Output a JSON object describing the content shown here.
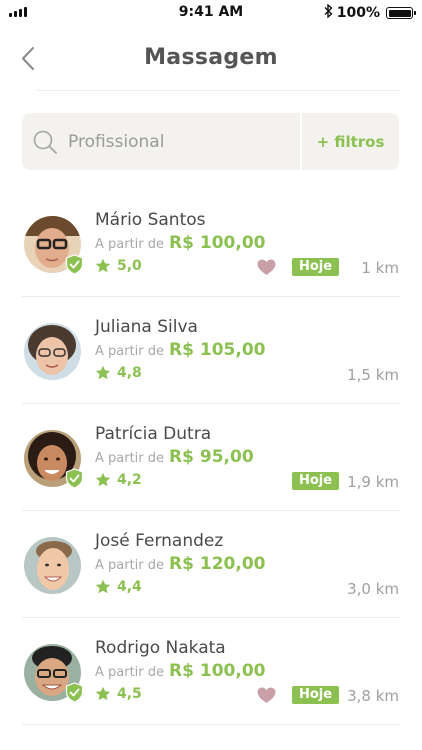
{
  "status": {
    "time": "9:41 AM",
    "battery": "100%"
  },
  "nav": {
    "title": "Massagem"
  },
  "search": {
    "placeholder": "Profissional",
    "filters_label": "+ filtros"
  },
  "list": {
    "items": [
      {
        "name": "Mário Santos",
        "price_prefix": "A partir de",
        "price": "R$ 100,00",
        "rating": "5,0",
        "badge": "Hoje",
        "distance": "1 km",
        "favorite": true,
        "verified": true
      },
      {
        "name": "Juliana Silva",
        "price_prefix": "A partir de",
        "price": "R$ 105,00",
        "rating": "4,8",
        "badge": "",
        "distance": "1,5 km",
        "favorite": false,
        "verified": false
      },
      {
        "name": "Patrícia Dutra",
        "price_prefix": "A partir de",
        "price": "R$ 95,00",
        "rating": "4,2",
        "badge": "Hoje",
        "distance": "1,9 km",
        "favorite": false,
        "verified": true
      },
      {
        "name": "José Fernandez",
        "price_prefix": "A partir de",
        "price": "R$ 120,00",
        "rating": "4,4",
        "badge": "",
        "distance": "3,0 km",
        "favorite": false,
        "verified": false
      },
      {
        "name": "Rodrigo Nakata",
        "price_prefix": "A partir de",
        "price": "R$ 100,00",
        "rating": "4,5",
        "badge": "Hoje",
        "distance": "3,8 km",
        "favorite": true,
        "verified": true
      }
    ]
  },
  "colors": {
    "accent": "#8cc152",
    "heart": "#c9a0a8",
    "search_bg": "#f3f2ef"
  },
  "icons": {
    "back": "chevron-left-icon",
    "search": "search-icon",
    "star": "star-icon",
    "heart": "heart-icon",
    "verified": "verified-shield-icon",
    "bluetooth": "bluetooth-icon",
    "battery": "battery-icon",
    "signal": "signal-icon"
  }
}
